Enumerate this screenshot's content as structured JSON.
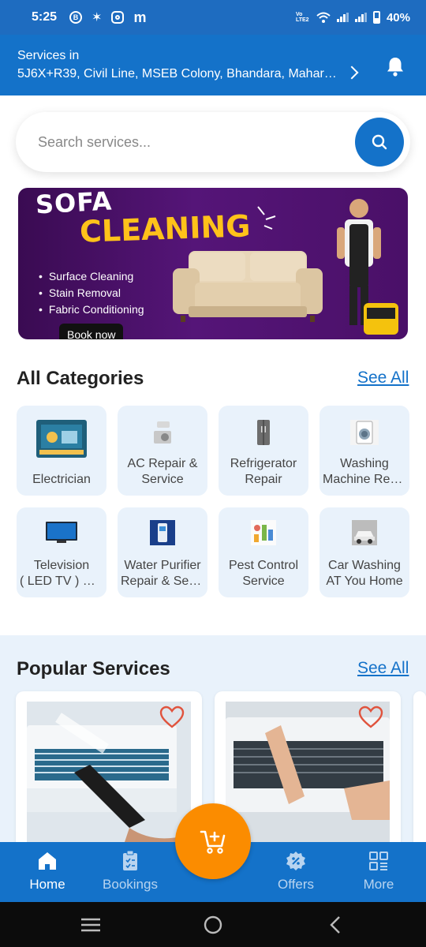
{
  "status_bar": {
    "time": "5:25",
    "battery": "40%",
    "network_label": "Vo LTE2",
    "icons": [
      "b-circle-icon",
      "asterisk-icon",
      "instagram-icon",
      "m-icon",
      "volte-icon",
      "wifi-icon",
      "signal-icon",
      "signal-icon",
      "battery-icon"
    ]
  },
  "header": {
    "label": "Services in",
    "address": "5J6X+R39, Civil Line, MSEB Colony, Bhandara, Maharashtra",
    "icons": [
      "chevron-right-icon",
      "bell-icon"
    ]
  },
  "search": {
    "placeholder": "Search services...",
    "icon": "search-icon"
  },
  "banner": {
    "line1": "SOFA",
    "line2": "CLEANING",
    "bullets": [
      "Surface Cleaning",
      "Stain Removal",
      "Fabric Conditioning"
    ],
    "cta": "Book now"
  },
  "categories": {
    "title": "All Categories",
    "see_all": "See All",
    "items": [
      {
        "line1": "Electrician",
        "line2": ""
      },
      {
        "line1": "AC Repair &",
        "line2": "Service"
      },
      {
        "line1": "Refrigerator",
        "line2": "Repair"
      },
      {
        "line1": "Washing",
        "line2": "Machine Repair"
      },
      {
        "line1": "Television",
        "line2": "( LED TV ) Repair"
      },
      {
        "line1": "Water Purifier",
        "line2": "Repair & Service"
      },
      {
        "line1": "Pest Control",
        "line2": "Service"
      },
      {
        "line1": "Car Washing",
        "line2": "AT You Home"
      }
    ]
  },
  "popular": {
    "title": "Popular Services",
    "see_all": "See All"
  },
  "bottom_nav": {
    "items": [
      {
        "label": "Home",
        "icon": "home-icon",
        "active": true
      },
      {
        "label": "Bookings",
        "icon": "clipboard-icon",
        "active": false
      },
      {
        "label": "Offers",
        "icon": "discount-badge-icon",
        "active": false
      },
      {
        "label": "More",
        "icon": "grid-icon",
        "active": false
      }
    ],
    "fab_icon": "cart-add-icon"
  },
  "colors": {
    "primary": "#1472c9",
    "accent": "#fb8c00",
    "tile_bg": "#e9f2fb",
    "banner_yellow": "#ffc21a",
    "banner_purple": "#551578"
  }
}
